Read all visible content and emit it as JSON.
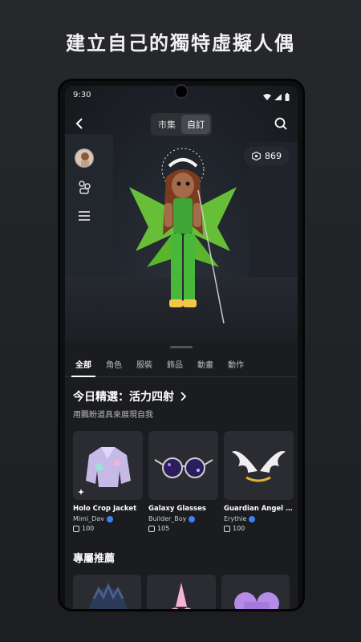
{
  "headline": "建立自己的獨特虛擬人偶",
  "status": {
    "time": "9:30"
  },
  "topnav": {
    "segments": [
      "市集",
      "自訂"
    ],
    "active_segment": 1
  },
  "robux_balance": "869",
  "tabs": [
    "全部",
    "角色",
    "服裝",
    "飾品",
    "動畫",
    "動作"
  ],
  "featured": {
    "title": "今日精選：活力四射",
    "subtitle": "用飄盼道具來展現自我",
    "items": [
      {
        "name": "Holo Crop Jacket",
        "creator": "Mimi_Dav",
        "price": "100"
      },
      {
        "name": "Galaxy Glasses",
        "creator": "Builder_Boy",
        "price": "105"
      },
      {
        "name": "Guardian Angel Ch...",
        "creator": "Erythie",
        "price": "100"
      }
    ]
  },
  "recommended": {
    "title": "專屬推薦"
  },
  "colors": {
    "accent_green": "#6fcf3a",
    "verified_blue": "#3b82f6",
    "background": "#1b1c1f"
  }
}
